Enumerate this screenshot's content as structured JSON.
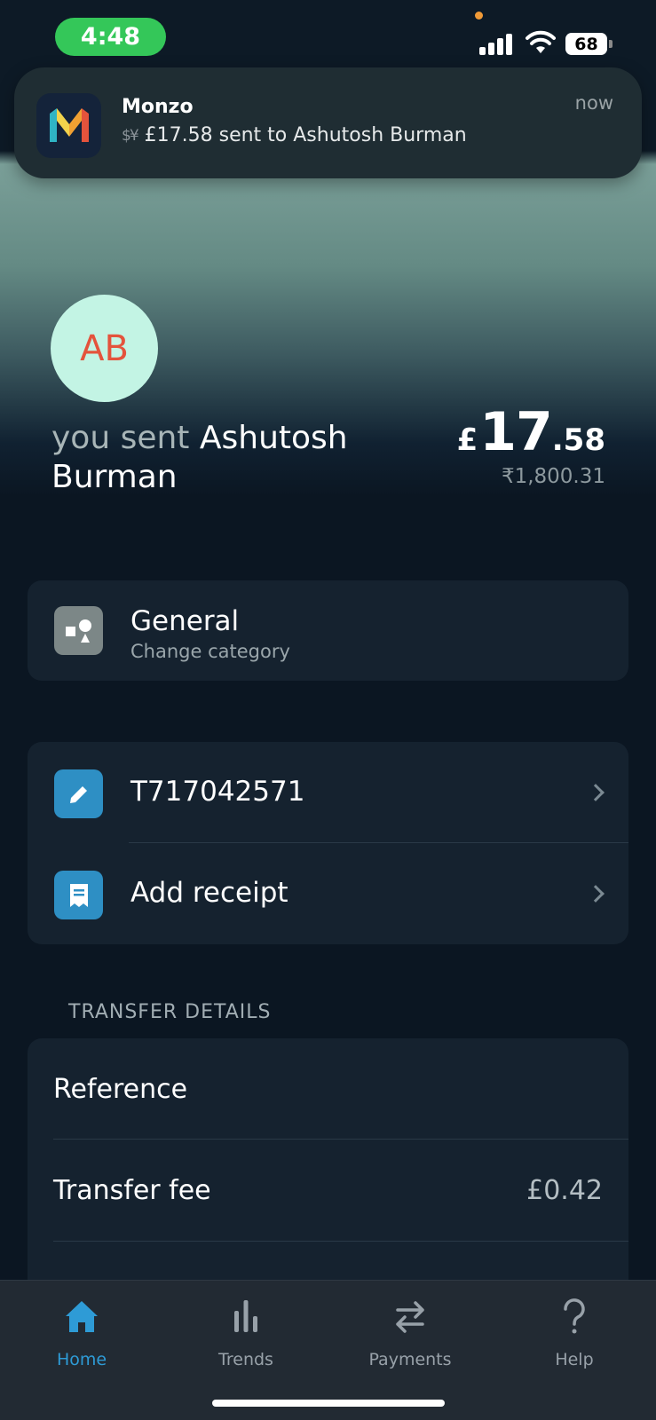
{
  "status_bar": {
    "time": "4:48",
    "battery": "68"
  },
  "notification": {
    "app": "Monzo",
    "time": "now",
    "fx_glyph": "$¥",
    "message": "£17.58 sent to Ashutosh Burman"
  },
  "transaction": {
    "avatar_initials": "AB",
    "prefix": "you sent",
    "payee": "Ashutosh Burman",
    "currency_symbol": "£",
    "amount_major": "17",
    "amount_minor": ".58",
    "local_amount": "₹1,800.31"
  },
  "category": {
    "title": "General",
    "subtitle": "Change category",
    "icon": "shapes-icon"
  },
  "actions": [
    {
      "label": "T717042571",
      "icon": "pencil-icon"
    },
    {
      "label": "Add receipt",
      "icon": "receipt-icon"
    }
  ],
  "transfer_details": {
    "section_label": "TRANSFER DETAILS",
    "reference_label": "Reference",
    "fee_label": "Transfer fee",
    "fee_value": "£0.42"
  },
  "tabs": [
    {
      "label": "Home",
      "icon": "home-icon",
      "active": true
    },
    {
      "label": "Trends",
      "icon": "bar-chart-icon",
      "active": false
    },
    {
      "label": "Payments",
      "icon": "transfer-arrows-icon",
      "active": false
    },
    {
      "label": "Help",
      "icon": "question-icon",
      "active": false
    }
  ],
  "colors": {
    "accent": "#2e9bd6",
    "avatar_bg": "#c3f4e4",
    "avatar_text": "#e4533c",
    "background": "#0b1622",
    "card": "#15222f"
  }
}
